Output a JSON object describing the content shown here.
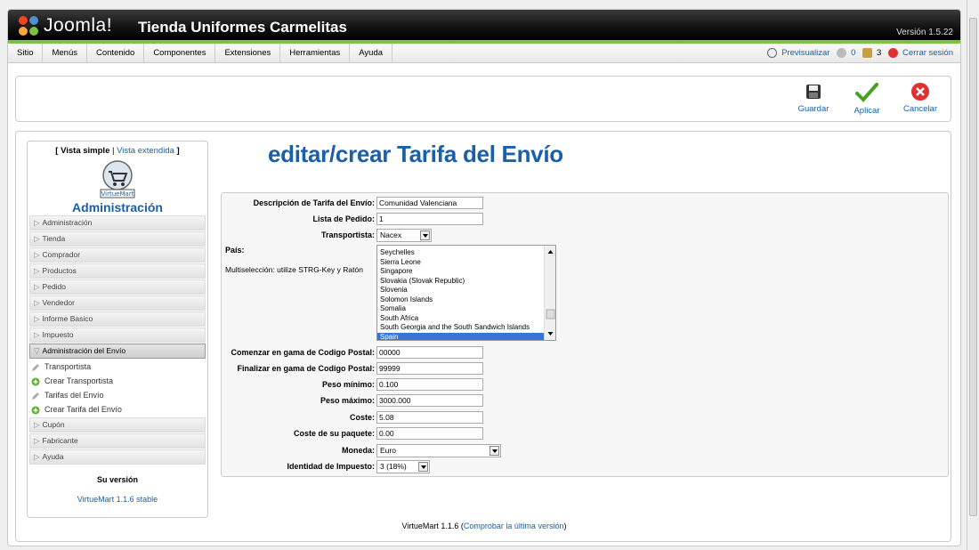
{
  "header": {
    "brand": "Joomla!",
    "site_title": "Tienda Uniformes Carmelitas",
    "version": "Versión 1.5.22"
  },
  "menu": {
    "items": [
      "Sitio",
      "Menús",
      "Contenido",
      "Componentes",
      "Extensiones",
      "Herramientas",
      "Ayuda"
    ]
  },
  "status": {
    "preview": "Previsualizar",
    "messages": "0",
    "users": "3",
    "logout": "Cerrar sesión"
  },
  "toolbar": {
    "save": "Guardar",
    "apply": "Aplicar",
    "cancel": "Cancelar"
  },
  "sidebar": {
    "view_simple": "[ Vista simple",
    "view_extended": "Vista extendida",
    "view_close": "]",
    "logo_text": "VirtueMart",
    "title": "Administración",
    "sections_top": [
      "Administración",
      "Tienda",
      "Comprador",
      "Productos",
      "Pedido",
      "Vendedor",
      "Informe Basico",
      "Impuesto"
    ],
    "active_section": "Administración del Envío",
    "sub_items": [
      "Transportista",
      "Crear Transportista",
      "Tarifas del Envío",
      "Crear Tarifa del Envío"
    ],
    "sections_bottom": [
      "Cupón",
      "Fabricante",
      "Ayuda"
    ],
    "su_version": "Su versión",
    "vm_version": "VirtueMart 1.1.6 stable"
  },
  "form": {
    "title": "editar/crear Tarifa del Envío",
    "desc_label": "Descripción de Tarifa del Envío:",
    "desc_value": "Comunidad Valenciana",
    "list_label": "Lista de Pedido:",
    "list_value": "1",
    "carrier_label": "Transportista:",
    "carrier_value": "Nacex",
    "country_label": "País:",
    "multisel_label": "Multiselección: utilize STRG-Key y Ratón",
    "countries": [
      "Seychelles",
      "Sierra Leone",
      "Singapore",
      "Slovakia (Slovak Republic)",
      "Slovenia",
      "Solomon Islands",
      "Somalia",
      "South Africa",
      "South Georgia and the South Sandwich Islands",
      "Spain"
    ],
    "zip_start_label": "Comenzar en gama de Codigo Postal:",
    "zip_start_value": "00000",
    "zip_end_label": "Finalizar en gama de Codigo Postal:",
    "zip_end_value": "99999",
    "weight_min_label": "Peso mínimo:",
    "weight_min_value": "0.100",
    "weight_max_label": "Peso máximo:",
    "weight_max_value": "3000.000",
    "cost_label": "Coste:",
    "cost_value": "5.08",
    "pkg_cost_label": "Coste de su paquete:",
    "pkg_cost_value": "0.00",
    "currency_label": "Moneda:",
    "currency_value": "Euro",
    "tax_label": "Identidad de Impuesto:",
    "tax_value": "3 (18%)"
  },
  "footer": {
    "text": "VirtueMart 1.1.6 (",
    "link": "Comprobar la última versión",
    "close": ")"
  }
}
